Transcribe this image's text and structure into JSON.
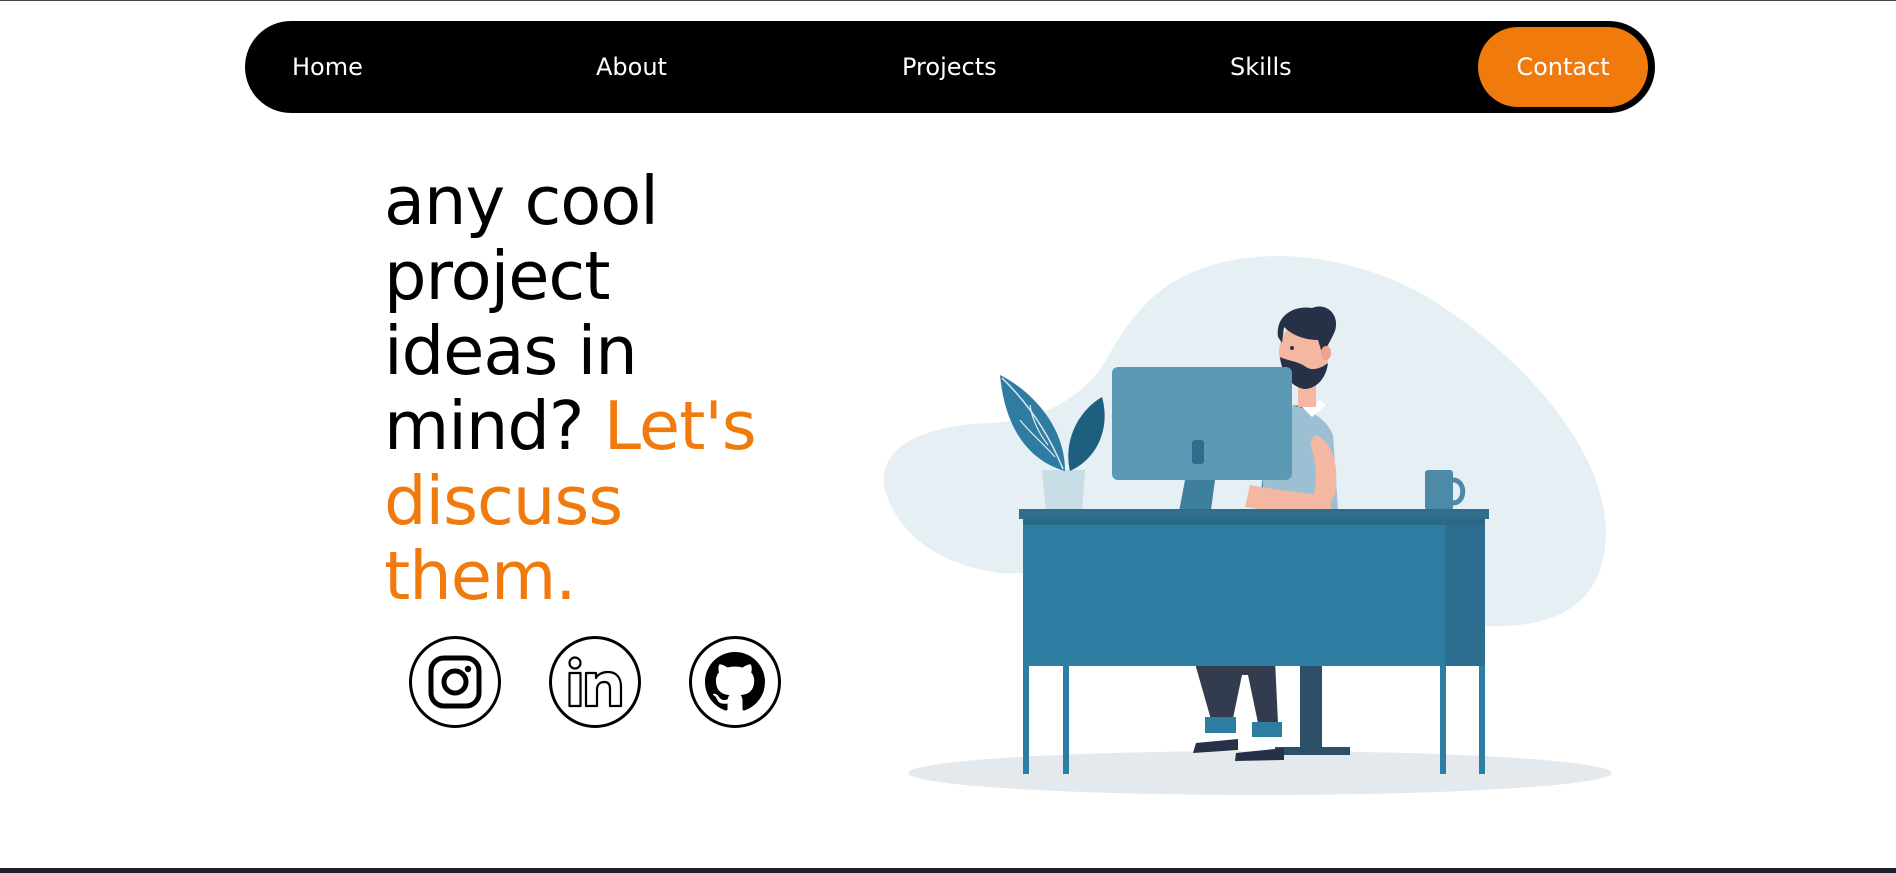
{
  "nav": {
    "home": "Home",
    "about": "About",
    "projects": "Projects",
    "skills": "Skills",
    "contact": "Contact"
  },
  "hero": {
    "line1": "any cool",
    "line2": "project",
    "line3": "ideas in",
    "line4_plain": "mind?",
    "line4_accent": "Let's",
    "line5": "discuss",
    "line6": "them."
  },
  "social": {
    "icons": [
      "instagram-icon",
      "linkedin-icon",
      "github-icon"
    ]
  },
  "colors": {
    "accent": "#f07a0c",
    "nav_bg": "#000000",
    "desk_blue": "#2e7da3"
  }
}
